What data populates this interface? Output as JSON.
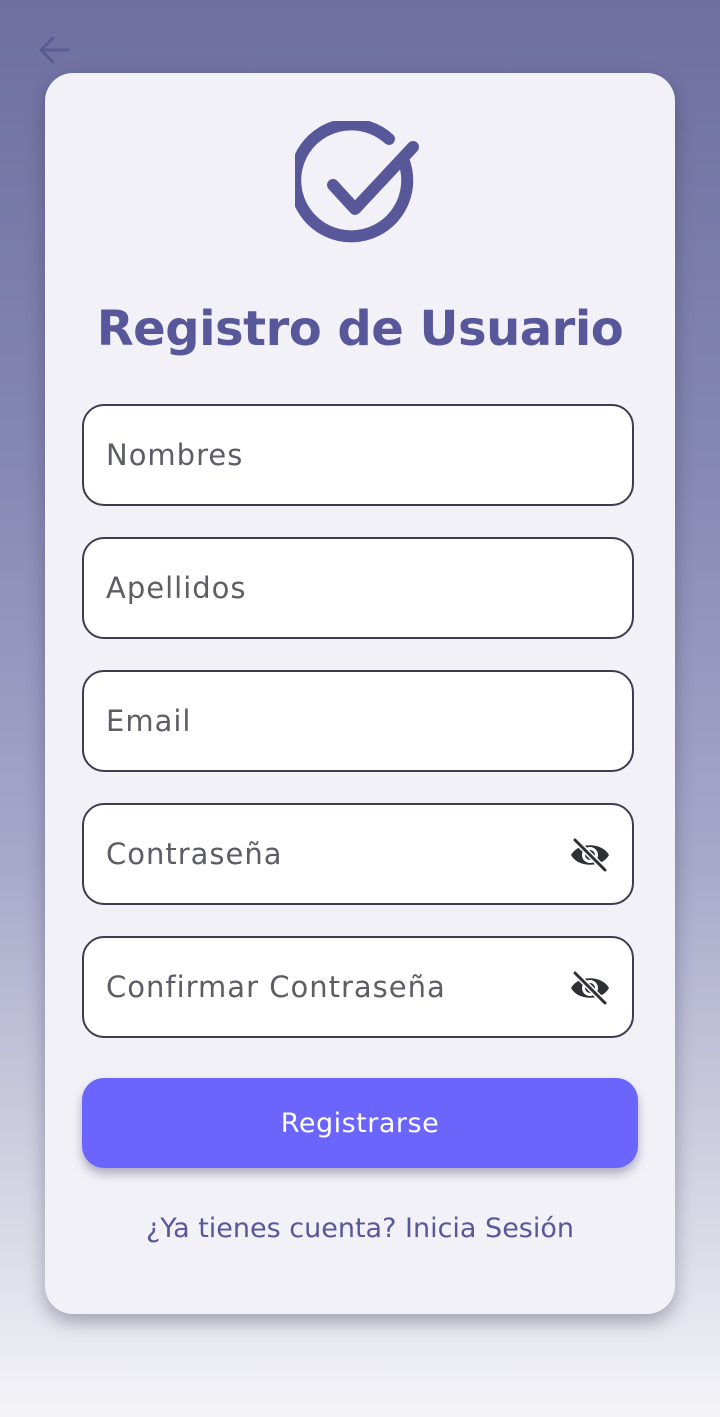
{
  "header": {
    "back_icon": "arrow-left-icon"
  },
  "form": {
    "logo_icon": "check-circle-icon",
    "title": "Registro de Usuario",
    "fields": [
      {
        "placeholder": "Nombres"
      },
      {
        "placeholder": "Apellidos"
      },
      {
        "placeholder": "Email"
      },
      {
        "placeholder": "Contraseña",
        "toggle_icon": "eye-off-icon"
      },
      {
        "placeholder": "Confirmar Contraseña",
        "toggle_icon": "eye-off-icon"
      }
    ],
    "submit_label": "Registrarse",
    "login_prompt": "¿Ya tienes cuenta? Inicia Sesión"
  },
  "colors": {
    "accent": "#6b65fe",
    "title": "#57579a",
    "card_background": "#f3f1f8",
    "field_border": "#3d3d4f"
  }
}
